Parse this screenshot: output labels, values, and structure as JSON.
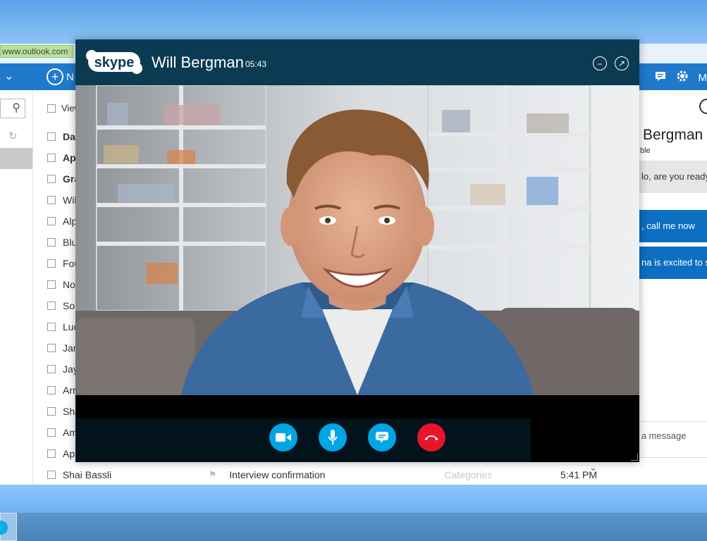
{
  "browser": {
    "url": "www.outlook.com"
  },
  "outlook": {
    "new_label": "N",
    "header_right_label": "M",
    "view_label": "View",
    "mail_rows": [
      {
        "sender": "Day",
        "bold": true
      },
      {
        "sender": "Ap",
        "bold": true
      },
      {
        "sender": "Gra",
        "bold": true
      },
      {
        "sender": "Wil",
        "bold": false
      },
      {
        "sender": "Alp",
        "bold": false
      },
      {
        "sender": "Blu",
        "bold": false
      },
      {
        "sender": "Fou",
        "bold": false
      },
      {
        "sender": "No",
        "bold": false
      },
      {
        "sender": "Sou",
        "bold": false
      },
      {
        "sender": "Luc",
        "bold": false
      },
      {
        "sender": "Jan",
        "bold": false
      },
      {
        "sender": "Jay",
        "bold": false
      },
      {
        "sender": "Arr",
        "bold": false
      },
      {
        "sender": "Sha",
        "bold": false
      },
      {
        "sender": "Am",
        "bold": false
      },
      {
        "sender": "App",
        "bold": false
      }
    ],
    "last_row": {
      "sender": "Shai Bassli",
      "subject": "Interview confirmation",
      "category": "Categories",
      "time": "5:41 PM"
    },
    "chat": {
      "contact_name": "Bergman",
      "contact_status": "ble",
      "messages": [
        {
          "text": "lo, are you ready",
          "direction": "in"
        },
        {
          "text": ", call me now",
          "direction": "out"
        },
        {
          "text": "na is excited to s",
          "direction": "out"
        }
      ],
      "input_placeholder": "d a message"
    }
  },
  "skype_call": {
    "logo_text": "skype",
    "caller": "Will Bergman",
    "timer": "05:43",
    "controls": [
      {
        "name": "video-button",
        "icon": "video-camera-icon",
        "color": "#00a5e6"
      },
      {
        "name": "mute-button",
        "icon": "microphone-icon",
        "color": "#00a5e6"
      },
      {
        "name": "chat-button",
        "icon": "chat-bubble-icon",
        "color": "#00a5e6"
      },
      {
        "name": "end-call-button",
        "icon": "hang-up-icon",
        "color": "#e8152a"
      }
    ],
    "accent": "#0b3b52"
  }
}
